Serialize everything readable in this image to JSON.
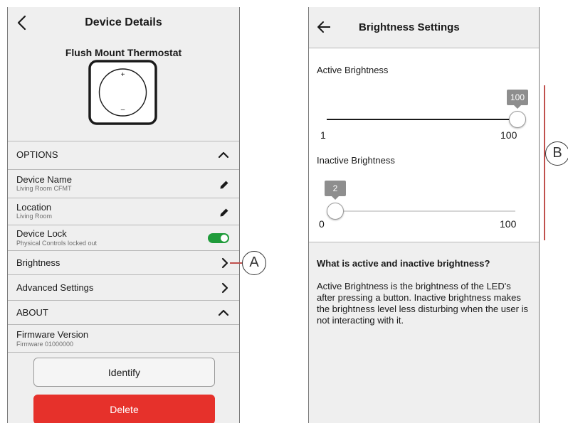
{
  "left_screen": {
    "title": "Device Details",
    "device_model": "Flush Mount Thermostat",
    "thermostat_plus": "+",
    "thermostat_minus": "–",
    "options_header": "OPTIONS",
    "device_name": {
      "label": "Device Name",
      "value": "Living Room CFMT"
    },
    "location": {
      "label": "Location",
      "value": "Living Room"
    },
    "device_lock": {
      "label": "Device Lock",
      "value": "Physical Controls locked out",
      "enabled": true
    },
    "brightness": "Brightness",
    "advanced_settings": "Advanced Settings",
    "about_header": "ABOUT",
    "firmware": {
      "label": "Firmware Version",
      "value": "Firmware 01000000"
    },
    "identify_button": "Identify",
    "delete_button": "Delete"
  },
  "right_screen": {
    "title": "Brightness Settings",
    "active": {
      "label": "Active Brightness",
      "value": "100",
      "min": "1",
      "max": "100"
    },
    "inactive": {
      "label": "Inactive Brightness",
      "value": "2",
      "min": "0",
      "max": "100"
    },
    "info_title": "What is active and inactive brightness?",
    "info_body": "Active Brightness is the brightness of the LED's after pressing a button. Inactive brightness makes the brightness level less disturbing when the user is not interacting with it."
  },
  "callouts": {
    "a": "A",
    "b": "B"
  },
  "colors": {
    "toggle_on": "#1f9b3a",
    "delete_red": "#e6312b",
    "callout_line": "#c0504d"
  }
}
